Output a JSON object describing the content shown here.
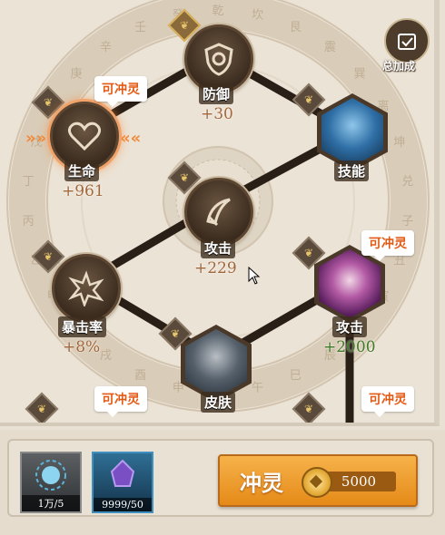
{
  "total_bonus": {
    "label": "总加成",
    "icon": "checklist-icon"
  },
  "charge_bubble_text": "可冲灵",
  "wheel_chars": [
    "乾",
    "坎",
    "艮",
    "震",
    "巽",
    "离",
    "坤",
    "兑",
    "子",
    "丑",
    "寅",
    "卯",
    "辰",
    "巳",
    "午",
    "未",
    "申",
    "酉",
    "戌",
    "亥",
    "甲",
    "乙",
    "丙",
    "丁",
    "戊",
    "己",
    "庚",
    "辛",
    "壬",
    "癸"
  ],
  "nodes": {
    "defense": {
      "name": "防御",
      "value": "+30",
      "icon": "shield-icon"
    },
    "life": {
      "name": "生命",
      "value": "+961",
      "icon": "heart-icon"
    },
    "skill": {
      "name": "技能",
      "icon": "spirit-portrait-icon"
    },
    "attack_center": {
      "name": "攻击",
      "value": "+229",
      "icon": "sword-icon"
    },
    "crit": {
      "name": "暴击率",
      "value": "+8%",
      "icon": "burst-icon"
    },
    "attack_right": {
      "name": "攻击",
      "value": "+2000",
      "icon": "portrait-icon"
    },
    "skin": {
      "name": "皮肤",
      "icon": "portrait-icon"
    }
  },
  "items": [
    {
      "name": "spirit-crystal-item",
      "count": "1万/5"
    },
    {
      "name": "purple-soul-item",
      "count": "9999/50"
    }
  ],
  "charge_button": {
    "label": "冲灵",
    "cost": "5000",
    "icon": "coin-icon"
  },
  "colors": {
    "accent": "#e58a18",
    "value_brown": "#a2673a",
    "value_green": "#3e7a25",
    "bubble_text": "#e25b16"
  }
}
